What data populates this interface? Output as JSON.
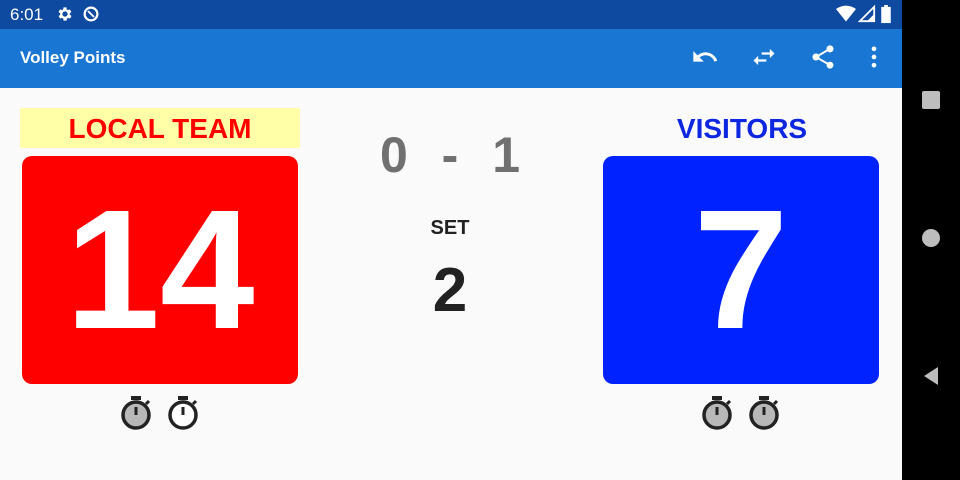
{
  "status_bar": {
    "time": "6:01",
    "icons": [
      "settings-icon",
      "data-saver-icon",
      "wifi-icon",
      "signal-icon",
      "battery-icon"
    ]
  },
  "app_bar": {
    "title": "Volley Points",
    "actions": [
      "undo-icon",
      "swap-icon",
      "share-icon",
      "more-vert-icon"
    ]
  },
  "local_team": {
    "name": "LOCAL TEAM",
    "score": "14",
    "timeouts": 2,
    "colors": {
      "name_text": "#ff0000",
      "name_bg": "#ffffa8",
      "card_bg": "#ff0000"
    }
  },
  "visitor_team": {
    "name": "VISITORS",
    "score": "7",
    "timeouts": 2,
    "colors": {
      "name_text": "#0d26e0",
      "card_bg": "#0022ff"
    }
  },
  "sets": {
    "local": "0",
    "separator": "-",
    "visitor": "1"
  },
  "current_set": {
    "label": "SET",
    "number": "2"
  },
  "nav_bar": [
    "recents-icon",
    "home-icon",
    "back-icon"
  ]
}
